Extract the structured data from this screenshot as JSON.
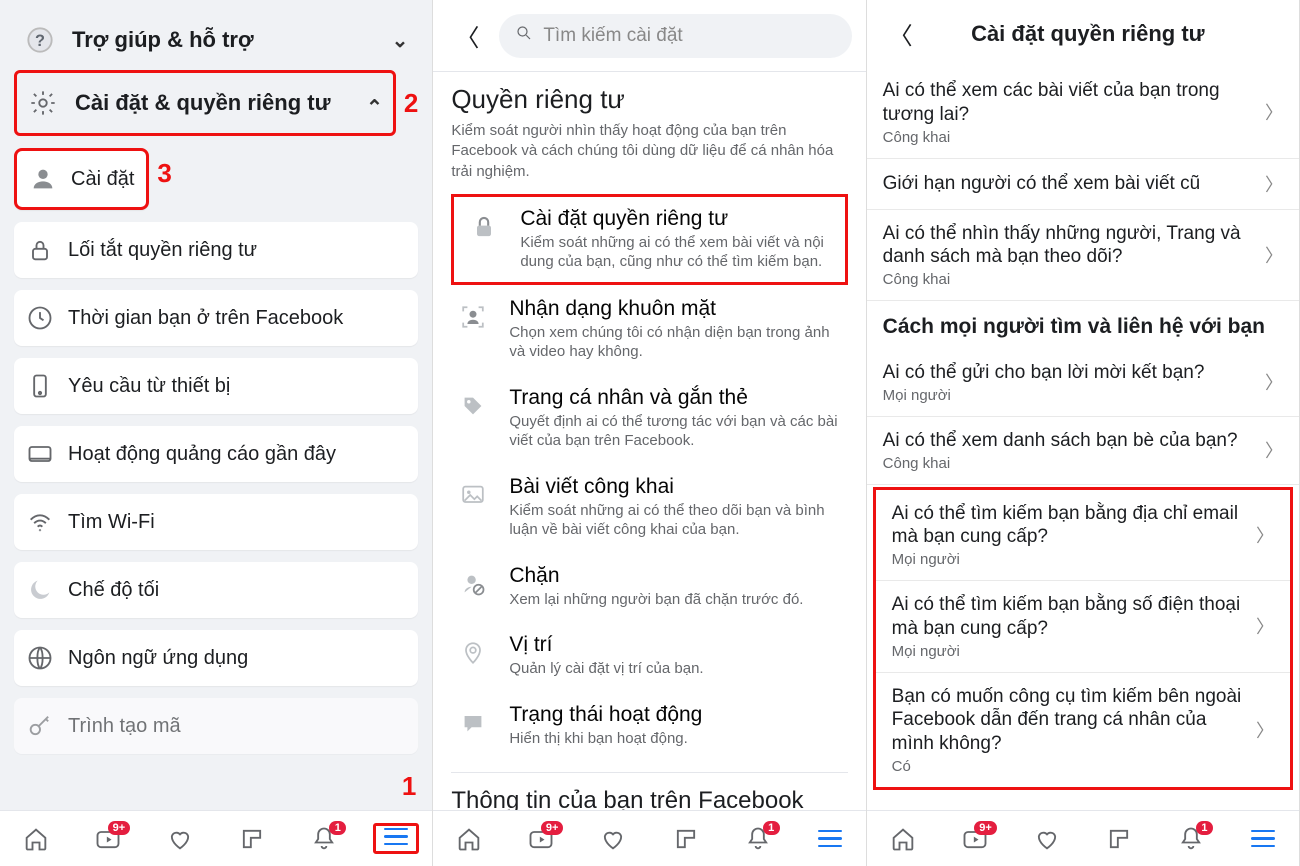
{
  "panel1": {
    "help": {
      "label": "Trợ giúp & hỗ trợ"
    },
    "settings_privacy": {
      "label": "Cài đặt & quyền riêng tư",
      "anno": "2"
    },
    "items": [
      {
        "label": "Cài đặt",
        "icon": "person-icon",
        "anno": "3",
        "highlight": true
      },
      {
        "label": "Lối tắt quyền riêng tư",
        "icon": "lock-icon"
      },
      {
        "label": "Thời gian bạn ở trên Facebook",
        "icon": "clock-icon"
      },
      {
        "label": "Yêu cầu từ thiết bị",
        "icon": "device-icon"
      },
      {
        "label": "Hoạt động quảng cáo gần đây",
        "icon": "ad-icon"
      },
      {
        "label": "Tìm Wi-Fi",
        "icon": "wifi-icon"
      },
      {
        "label": "Chế độ tối",
        "icon": "moon-icon"
      },
      {
        "label": "Ngôn ngữ ứng dụng",
        "icon": "globe-icon"
      },
      {
        "label": "Trình tạo mã",
        "icon": "key-icon"
      }
    ],
    "nav_anno": "1"
  },
  "panel2": {
    "search_placeholder": "Tìm kiếm cài đặt",
    "section_title": "Quyền riêng tư",
    "section_desc": "Kiểm soát người nhìn thấy hoạt động của bạn trên Facebook và cách chúng tôi dùng dữ liệu để cá nhân hóa trải nghiệm.",
    "rows": [
      {
        "title": "Cài đặt quyền riêng tư",
        "desc": "Kiểm soát những ai có thể xem bài viết và nội dung của bạn, cũng như có thể tìm kiếm bạn.",
        "icon": "lock-icon",
        "highlight": true
      },
      {
        "title": "Nhận dạng khuôn mặt",
        "desc": "Chọn xem chúng tôi có nhận diện bạn trong ảnh và video hay không.",
        "icon": "face-icon"
      },
      {
        "title": "Trang cá nhân và gắn thẻ",
        "desc": "Quyết định ai có thể tương tác với bạn và các bài viết của bạn trên Facebook.",
        "icon": "tag-icon"
      },
      {
        "title": "Bài viết công khai",
        "desc": "Kiểm soát những ai có thể theo dõi bạn và bình luận về bài viết công khai của bạn.",
        "icon": "image-icon"
      },
      {
        "title": "Chặn",
        "desc": "Xem lại những người bạn đã chặn trước đó.",
        "icon": "block-icon"
      },
      {
        "title": "Vị trí",
        "desc": "Quản lý cài đặt vị trí của bạn.",
        "icon": "pin-icon"
      },
      {
        "title": "Trạng thái hoạt động",
        "desc": "Hiển thị khi bạn hoạt động.",
        "icon": "chat-icon"
      }
    ],
    "section2_title": "Thông tin của bạn trên Facebook"
  },
  "panel3": {
    "title": "Cài đặt quyền riêng tư",
    "rows1": [
      {
        "title": "Ai có thể xem các bài viết của bạn trong tương lai?",
        "value": "Công khai"
      },
      {
        "title": "Giới hạn người có thể xem bài viết cũ",
        "value": ""
      },
      {
        "title": "Ai có thể nhìn thấy những người, Trang và danh sách mà bạn theo dõi?",
        "value": "Công khai"
      }
    ],
    "section2": "Cách mọi người tìm và liên hệ với bạn",
    "rows2": [
      {
        "title": "Ai có thể gửi cho bạn lời mời kết bạn?",
        "value": "Mọi người"
      },
      {
        "title": "Ai có thể xem danh sách bạn bè của bạn?",
        "value": "Công khai"
      }
    ],
    "rows3": [
      {
        "title": "Ai có thể tìm kiếm bạn bằng địa chỉ email mà bạn cung cấp?",
        "value": "Mọi người"
      },
      {
        "title": "Ai có thể tìm kiếm bạn bằng số điện thoại mà bạn cung cấp?",
        "value": "Mọi người"
      },
      {
        "title": "Bạn có muốn công cụ tìm kiếm bên ngoài Facebook dẫn đến trang cá nhân của mình không?",
        "value": "Có"
      }
    ]
  },
  "nav": {
    "badge_watch": "9+",
    "badge_bell": "1"
  }
}
